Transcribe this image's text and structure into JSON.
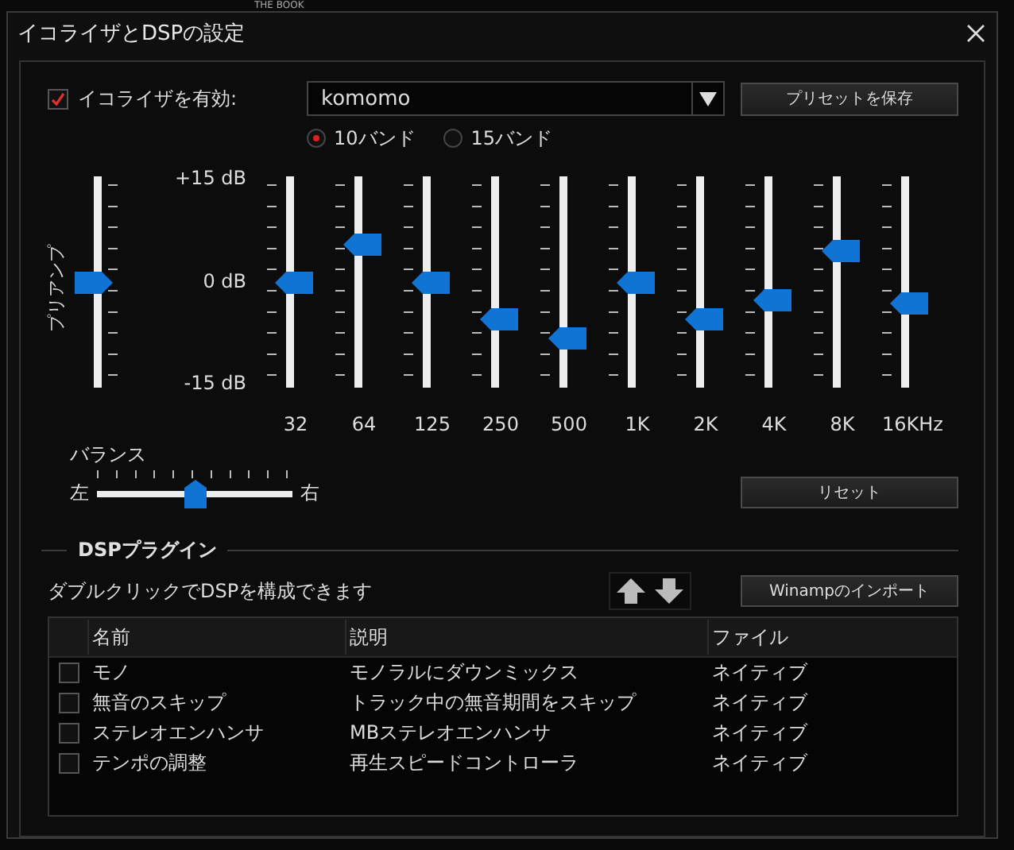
{
  "background": {
    "title": "THE BOOK"
  },
  "window": {
    "title": "イコライザとDSPの設定"
  },
  "equalizer": {
    "enabled": {
      "label": "イコライザを有効:",
      "checked": true
    },
    "preset": {
      "value": "komomo"
    },
    "save_button": "プリセットを保存",
    "band_modes": [
      {
        "label": "10バンド",
        "selected": true
      },
      {
        "label": "15バンド",
        "selected": false
      }
    ],
    "preamp": {
      "label": "プリアンプ",
      "level": 0.5
    },
    "scale": [
      "+15 dB",
      "0 dB",
      "-15 dB"
    ],
    "bands": [
      {
        "label": "32",
        "level": 0.5
      },
      {
        "label": "64",
        "level": 0.68
      },
      {
        "label": "125",
        "level": 0.5
      },
      {
        "label": "250",
        "level": 0.32
      },
      {
        "label": "500",
        "level": 0.23
      },
      {
        "label": "1K",
        "level": 0.5
      },
      {
        "label": "2K",
        "level": 0.32
      },
      {
        "label": "4K",
        "level": 0.41
      },
      {
        "label": "8K",
        "level": 0.65
      },
      {
        "label": "16KHz",
        "level": 0.4
      }
    ],
    "balance": {
      "label": "バランス",
      "left": "左",
      "right": "右",
      "level": 0.5
    },
    "reset_button": "リセット"
  },
  "dsp": {
    "title": "DSPプラグイン",
    "hint": "ダブルクリックでDSPを構成できます",
    "import_button": "Winampのインポート",
    "table": {
      "columns": [
        "名前",
        "説明",
        "ファイル"
      ],
      "rows": [
        {
          "checked": false,
          "cells": [
            "モノ",
            "モノラルにダウンミックス",
            "ネイティブ"
          ]
        },
        {
          "checked": false,
          "cells": [
            "無音のスキップ",
            "トラック中の無音期間をスキップ",
            "ネイティブ"
          ]
        },
        {
          "checked": false,
          "cells": [
            "ステレオエンハンサ",
            "MBステレオエンハンサ",
            "ネイティブ"
          ]
        },
        {
          "checked": false,
          "cells": [
            "テンポの調整",
            "再生スピードコントローラ",
            "ネイティブ"
          ]
        }
      ]
    }
  }
}
